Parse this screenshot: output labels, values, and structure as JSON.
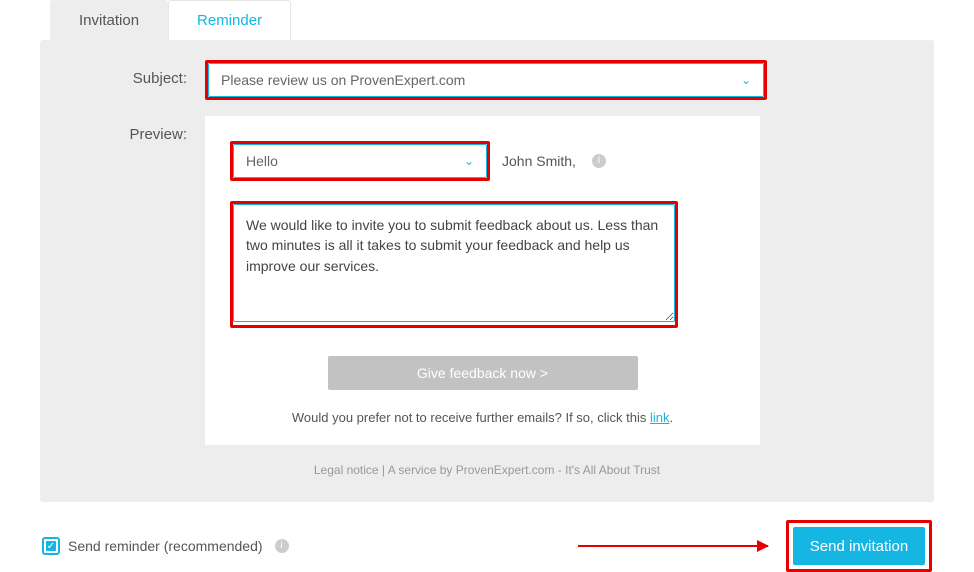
{
  "tabs": {
    "invitation": "Invitation",
    "reminder": "Reminder"
  },
  "labels": {
    "subject": "Subject:",
    "preview": "Preview:"
  },
  "subject": {
    "selected": "Please review us on ProvenExpert.com"
  },
  "preview": {
    "greeting_selected": "Hello",
    "recipient_name": "John Smith,",
    "message": "We would like to invite you to submit feedback about us. Less than two minutes is all it takes to submit your feedback and help us improve our services.",
    "cta_label": "Give feedback now >",
    "optout_text": "Would you prefer not to receive further emails? If so, click this ",
    "optout_link": "link"
  },
  "legal": "Legal notice | A service by ProvenExpert.com - It's All About Trust",
  "footer": {
    "reminder_label": "Send reminder (recommended)",
    "send_label": "Send invitation"
  }
}
